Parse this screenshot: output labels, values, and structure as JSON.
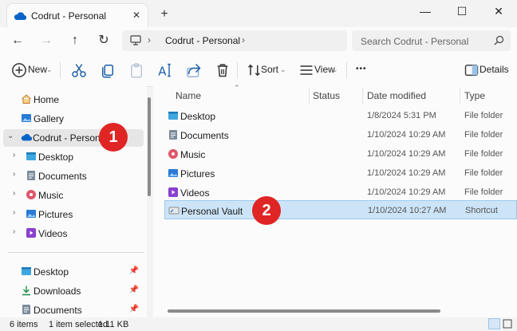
{
  "tab": {
    "title": "Codrut - Personal",
    "close": "✕",
    "new_tab": "+"
  },
  "window": {
    "minimize": "—",
    "maximize": "☐",
    "close": "✕"
  },
  "address": {
    "crumb": "Codrut - Personal",
    "sep": "›"
  },
  "search": {
    "placeholder": "Search Codrut - Personal"
  },
  "toolbar": {
    "new": "New",
    "sort": "Sort",
    "view": "View",
    "more": "•••",
    "details": "Details"
  },
  "nav": {
    "home": "Home",
    "gallery": "Gallery",
    "onedrive": "Codrut - Personal",
    "desktop": "Desktop",
    "documents": "Documents",
    "music": "Music",
    "pictures": "Pictures",
    "videos": "Videos",
    "quick_desktop": "Desktop",
    "quick_downloads": "Downloads",
    "quick_documents": "Documents"
  },
  "columns": {
    "name": "Name",
    "status": "Status",
    "date": "Date modified",
    "type": "Type"
  },
  "files": [
    {
      "name": "Desktop",
      "date": "1/8/2024 5:31 PM",
      "type": "File folder"
    },
    {
      "name": "Documents",
      "date": "1/10/2024 10:29 AM",
      "type": "File folder"
    },
    {
      "name": "Music",
      "date": "1/10/2024 10:29 AM",
      "type": "File folder"
    },
    {
      "name": "Pictures",
      "date": "1/10/2024 10:29 AM",
      "type": "File folder"
    },
    {
      "name": "Videos",
      "date": "1/10/2024 10:29 AM",
      "type": "File folder"
    },
    {
      "name": "Personal Vault",
      "date": "1/10/2024 10:27 AM",
      "type": "Shortcut"
    }
  ],
  "status": {
    "items": "6 items",
    "selected": "1 item selected",
    "size": "1.11 KB"
  },
  "badges": {
    "one": "1",
    "two": "2"
  },
  "colors": {
    "accent": "#0067c0",
    "selection": "#cce4f7",
    "badge": "#e02525"
  }
}
